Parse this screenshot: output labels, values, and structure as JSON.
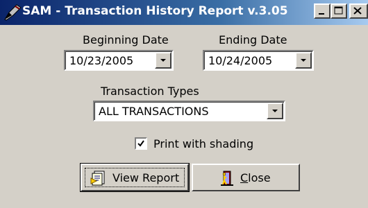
{
  "window": {
    "title": "SAM - Transaction History Report v.3.05",
    "icon": "pen-icon",
    "controls": {
      "minimize_icon": "minimize-icon",
      "maximize_icon": "maximize-icon",
      "close_icon": "close-icon"
    }
  },
  "form": {
    "beginning_date": {
      "label": "Beginning Date",
      "value": "10/23/2005"
    },
    "ending_date": {
      "label": "Ending Date",
      "value": "10/24/2005"
    },
    "transaction_types": {
      "label": "Transaction Types",
      "value": "ALL TRANSACTIONS"
    },
    "print_with_shading": {
      "label": "Print with shading",
      "checked": true
    }
  },
  "buttons": {
    "view_report": {
      "label": "View Report",
      "icon": "report-icon"
    },
    "close": {
      "label_mnemonic": "C",
      "label_rest": "lose",
      "icon": "door-exit-icon"
    }
  },
  "colors": {
    "titlebar_start": "#0a246a",
    "titlebar_end": "#a6caf0",
    "face": "#d4d0c8"
  }
}
